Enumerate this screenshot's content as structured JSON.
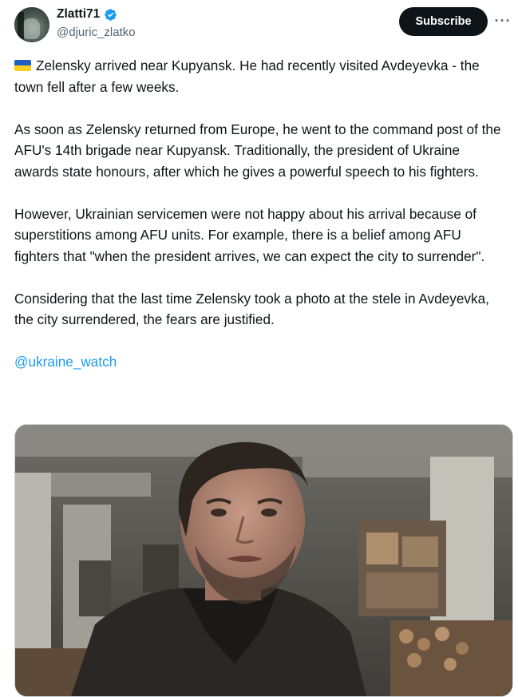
{
  "author": {
    "display_name": "Zlatti71",
    "handle": "@djuric_zlatko",
    "verified": true
  },
  "actions": {
    "subscribe_label": "Subscribe",
    "more_icon": "ellipsis-icon"
  },
  "tweet": {
    "flag_icon": "ukraine-flag-icon",
    "paragraphs": [
      "Zelensky arrived near Kupyansk. He had recently visited Avdeyevka - the town fell after a few weeks.",
      "As soon as Zelensky returned from Europe, he went to the command post of the AFU's 14th brigade near Kupyansk. Traditionally, the president of Ukraine awards state honours, after which he gives a powerful speech to his fighters.",
      "However, Ukrainian servicemen were not happy about his arrival because of superstitions among AFU units. For example, there is a belief among AFU fighters that \"when the president arrives, we can expect the city to surrender\".",
      "Considering that the last time Zelensky took a photo at the stele in Avdeyevka, the city surrendered, the fears are justified."
    ],
    "mention": "@ukraine_watch"
  },
  "colors": {
    "link": "#1d9bf0",
    "verified": "#1d9bf0",
    "text": "#0f1419",
    "secondary": "#536471"
  }
}
